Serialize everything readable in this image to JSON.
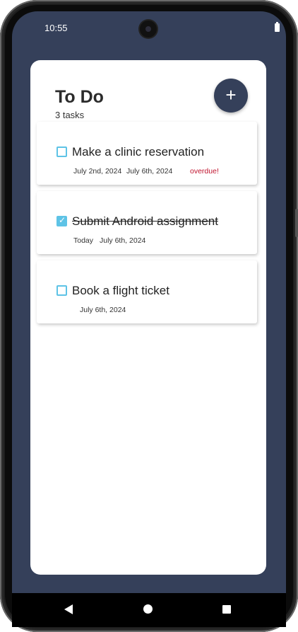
{
  "status_bar": {
    "time": "10:55"
  },
  "header": {
    "title": "To Do",
    "task_count": "3 tasks",
    "add_button": "+"
  },
  "tasks": [
    {
      "name": "Make a clinic reservation",
      "checked": false,
      "date1": "July 2nd, 2024",
      "date2": "July 6th, 2024",
      "status": "overdue!"
    },
    {
      "name": "Submit Android assignment",
      "checked": true,
      "date1": "Today",
      "date2": "July 6th, 2024"
    },
    {
      "name": "Book a flight ticket",
      "checked": false,
      "date2": "July 6th, 2024"
    }
  ],
  "colors": {
    "accent": "#35405a",
    "checkbox": "#5ec3e6",
    "overdue": "#c0152f"
  },
  "icons": {
    "add": "plus-icon",
    "check": "checkmark-icon",
    "back": "back-triangle-icon",
    "home": "home-circle-icon",
    "recents": "recents-square-icon",
    "battery": "battery-icon"
  }
}
